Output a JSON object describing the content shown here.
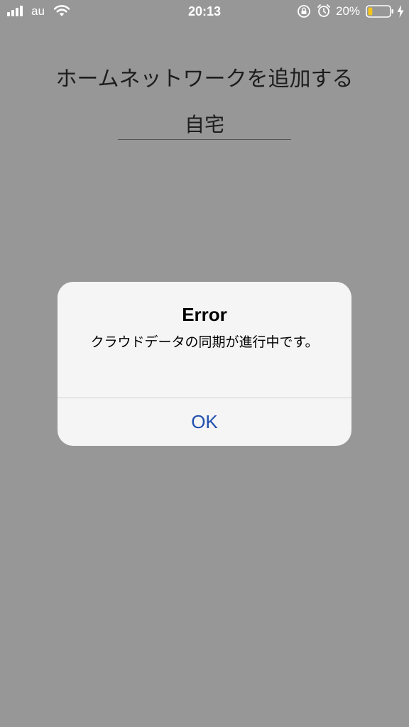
{
  "status_bar": {
    "carrier": "au",
    "time": "20:13",
    "battery_percent": "20%",
    "battery_level": 0.2,
    "icons": [
      "signal-icon",
      "wifi-icon",
      "lock-rotation-icon",
      "alarm-icon",
      "battery-icon",
      "charging-icon"
    ]
  },
  "page": {
    "title": "ホームネットワークを追加する",
    "name_value": "自宅"
  },
  "alert": {
    "title": "Error",
    "message": "クラウドデータの同期が進行中です。",
    "ok_label": "OK"
  },
  "colors": {
    "dim_background": "#979797",
    "alert_background": "#f5f5f5",
    "alert_button": "#1f4fae",
    "battery_fill": "#f5c518"
  }
}
